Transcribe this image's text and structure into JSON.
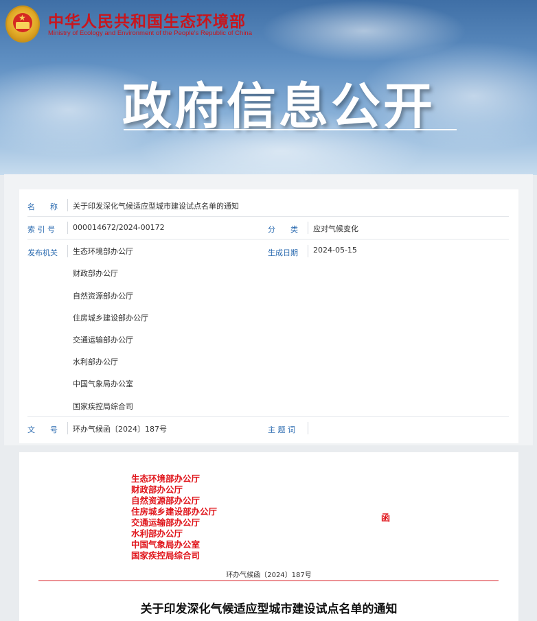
{
  "header": {
    "ministry_cn": "中华人民共和国生态环境部",
    "ministry_en": "Ministry of Ecology and Environment of the People's Republic of China",
    "banner_title": "政府信息公开",
    "emblem_icon": "national-emblem-icon"
  },
  "info": {
    "name_label": "名　　称",
    "name_value": "关于印发深化气候适应型城市建设试点名单的通知",
    "index_label": "索 引 号",
    "index_value": "000014672/2024-00172",
    "category_label": "分　　类",
    "category_value": "应对气候变化",
    "issuer_label": "发布机关",
    "issuers": [
      "生态环境部办公厅",
      "财政部办公厅",
      "自然资源部办公厅",
      "住房城乡建设部办公厅",
      "交通运输部办公厅",
      "水利部办公厅",
      "中国气象局办公室",
      "国家疾控局综合司"
    ],
    "date_label": "生成日期",
    "date_value": "2024-05-15",
    "docno_label": "文　　号",
    "docno_value": "环办气候函〔2024〕187号",
    "subject_label": "主 题 词",
    "subject_value": ""
  },
  "document": {
    "recipients": [
      "生态环境部办公厅",
      "财政部办公厅",
      "自然资源部办公厅",
      "住房城乡建设部办公厅",
      "交通运输部办公厅",
      "水利部办公厅",
      "中国气象局办公室",
      "国家疾控局综合司"
    ],
    "han": "函",
    "doc_number": "环办气候函〔2024〕187号",
    "title": "关于印发深化气候适应型城市建设试点名单的通知"
  },
  "colors": {
    "accent_red": "#e0151b",
    "label_blue": "#2b6bb0"
  }
}
